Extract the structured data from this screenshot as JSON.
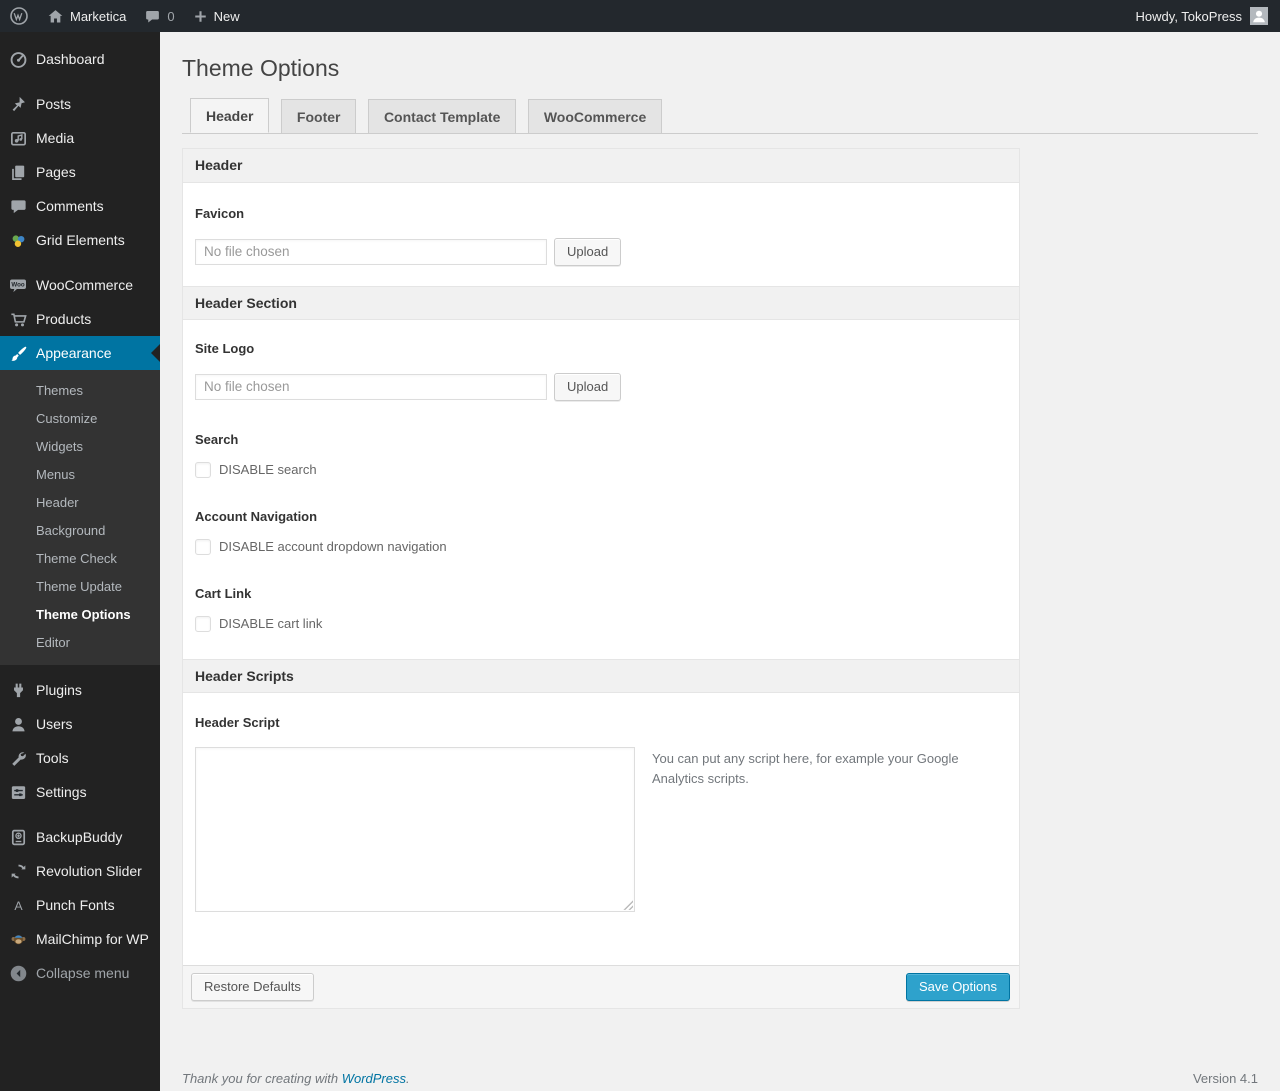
{
  "admin_bar": {
    "site_name": "Marketica",
    "comments_count": "0",
    "new_label": "New",
    "howdy": "Howdy, TokoPress"
  },
  "sidebar": {
    "items": [
      {
        "label": "Dashboard",
        "icon": "dashboard-icon"
      },
      {
        "label": "Posts",
        "icon": "pushpin-icon"
      },
      {
        "label": "Media",
        "icon": "media-icon"
      },
      {
        "label": "Pages",
        "icon": "pages-icon"
      },
      {
        "label": "Comments",
        "icon": "comments-icon"
      },
      {
        "label": "Grid Elements",
        "icon": "grid-elements-icon"
      },
      {
        "label": "WooCommerce",
        "icon": "woocommerce-icon"
      },
      {
        "label": "Products",
        "icon": "cart-icon"
      },
      {
        "label": "Appearance",
        "icon": "paintbrush-icon"
      },
      {
        "label": "Plugins",
        "icon": "plugin-icon"
      },
      {
        "label": "Users",
        "icon": "users-icon"
      },
      {
        "label": "Tools",
        "icon": "wrench-icon"
      },
      {
        "label": "Settings",
        "icon": "settings-icon"
      },
      {
        "label": "BackupBuddy",
        "icon": "backupbuddy-icon"
      },
      {
        "label": "Revolution Slider",
        "icon": "revslider-icon"
      },
      {
        "label": "Punch Fonts",
        "icon": "punch-fonts-icon"
      },
      {
        "label": "MailChimp for WP",
        "icon": "mailchimp-icon"
      },
      {
        "label": "Collapse menu",
        "icon": "collapse-icon"
      }
    ],
    "appearance_submenu": [
      "Themes",
      "Customize",
      "Widgets",
      "Menus",
      "Header",
      "Background",
      "Theme Check",
      "Theme Update",
      "Theme Options",
      "Editor"
    ]
  },
  "page": {
    "title": "Theme Options",
    "tabs": [
      {
        "label": "Header"
      },
      {
        "label": "Footer"
      },
      {
        "label": "Contact Template"
      },
      {
        "label": "WooCommerce"
      }
    ]
  },
  "panel": {
    "section_headers": {
      "header": "Header",
      "header_section": "Header Section",
      "header_scripts": "Header Scripts"
    },
    "fields": {
      "favicon": {
        "label": "Favicon",
        "placeholder": "No file chosen",
        "button": "Upload"
      },
      "site_logo": {
        "label": "Site Logo",
        "placeholder": "No file chosen",
        "button": "Upload"
      },
      "search": {
        "label": "Search",
        "checkbox_label": "DISABLE search"
      },
      "account_navigation": {
        "label": "Account Navigation",
        "checkbox_label": "DISABLE account dropdown navigation"
      },
      "cart_link": {
        "label": "Cart Link",
        "checkbox_label": "DISABLE cart link"
      },
      "header_script": {
        "label": "Header Script",
        "value": "",
        "help": "You can put any script here, for example your Google Analytics scripts."
      }
    },
    "footer": {
      "restore_label": "Restore Defaults",
      "save_label": "Save Options"
    }
  },
  "page_footer": {
    "thanks_prefix": "Thank you for creating with ",
    "wordpress_link": "WordPress",
    "thanks_suffix": ".",
    "version": "Version 4.1"
  },
  "colors": {
    "accent": "#0074a2",
    "primary_button": "#2ea2cc",
    "admin_bar_bg": "#23282d",
    "sidebar_bg": "#222222",
    "submenu_bg": "#333333",
    "page_bg": "#f1f1f1"
  }
}
